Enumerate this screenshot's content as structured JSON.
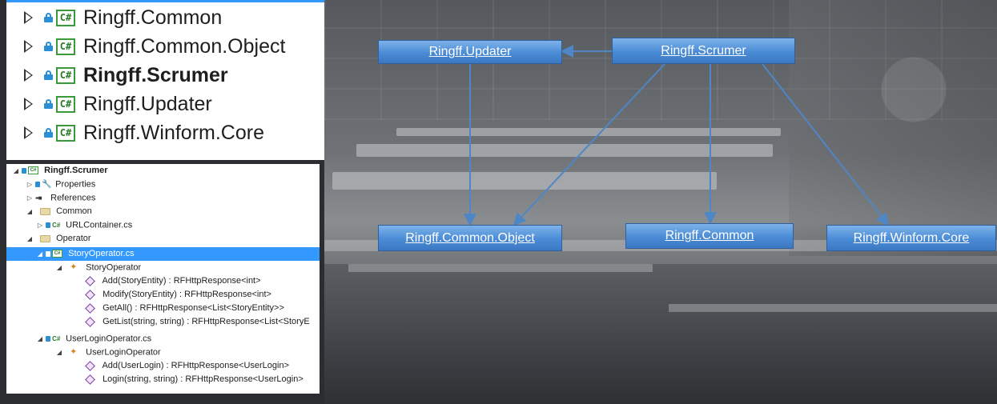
{
  "top_panel": {
    "items": [
      {
        "label": "Ringff.Common",
        "bold": false
      },
      {
        "label": "Ringff.Common.Object",
        "bold": false
      },
      {
        "label": "Ringff.Scrumer",
        "bold": true
      },
      {
        "label": "Ringff.Updater",
        "bold": false
      },
      {
        "label": "Ringff.Winform.Core",
        "bold": false
      }
    ]
  },
  "tree": {
    "project": "Ringff.Scrumer",
    "properties": "Properties",
    "references": "References",
    "folder_common": "Common",
    "urlcontainer": "URLContainer.cs",
    "folder_operator": "Operator",
    "story_file": "StoryOperator.cs",
    "story_class": "StoryOperator",
    "story_methods": [
      "Add(StoryEntity) : RFHttpResponse<int>",
      "Modify(StoryEntity) : RFHttpResponse<int>",
      "GetAll() : RFHttpResponse<List<StoryEntity>>",
      "GetList(string, string) : RFHttpResponse<List<StoryE"
    ],
    "login_file": "UserLoginOperator.cs",
    "login_class": "UserLoginOperator",
    "login_methods": [
      "Add(UserLogin) : RFHttpResponse<UserLogin>",
      "Login(string, string) : RFHttpResponse<UserLogin>"
    ]
  },
  "diagram": {
    "updater": "Ringff.Updater",
    "scrumer": "Ringff.Scrumer",
    "common_object": "Ringff.Common.Object",
    "common": "Ringff.Common",
    "winform_core": "Ringff.Winform.Core",
    "edge_color": "#4f86c6"
  }
}
